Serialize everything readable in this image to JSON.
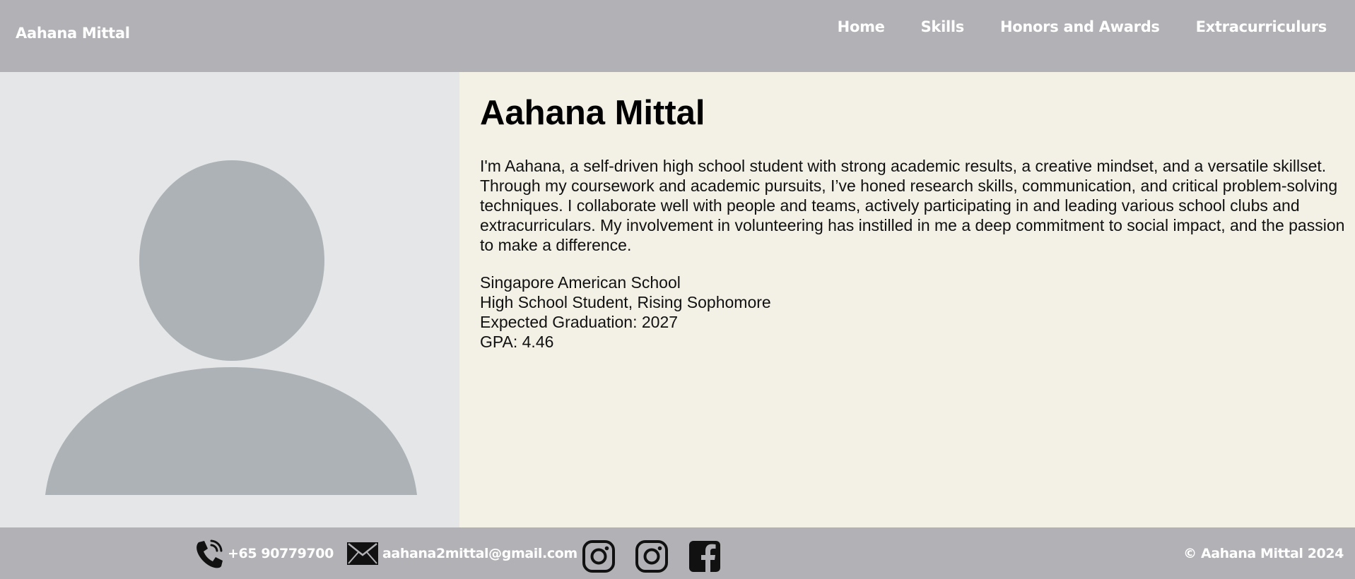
{
  "header": {
    "brand": "Aahana Mittal",
    "nav": [
      {
        "label": "Home"
      },
      {
        "label": "Skills"
      },
      {
        "label": "Honors and Awards"
      },
      {
        "label": "Extracurriculurs"
      }
    ]
  },
  "profile": {
    "avatar_icon": "user-silhouette-icon",
    "name": "Aahana Mittal",
    "bio": "I'm Aahana, a self-driven high school student with strong academic results, a creative mindset, and a versatile skillset. Through my coursework and academic pursuits, I’ve honed research skills, communication, and critical problem-solving techniques. I collaborate well with people and teams, actively participating in and leading various school clubs and extracurriculars. My involvement in volunteering has instilled in me a deep commitment to social impact, and the passion to make a difference.",
    "details": [
      "Singapore American School",
      "High School Student, Rising Sophomore",
      "Expected Graduation: 2027",
      "GPA: 4.46"
    ]
  },
  "footer": {
    "phone_icon": "phone-icon",
    "phone": "+65 90779700",
    "email_icon": "envelope-icon",
    "email": "aahana2mittal@gmail.com",
    "social_icons": [
      "instagram-icon",
      "instagram-icon",
      "facebook-icon"
    ],
    "copyright": "© Aahana Mittal 2024"
  },
  "colors": {
    "header_bg": "#b2b1b6",
    "left_panel_bg": "#e5e6e8",
    "content_bg": "#f3f1e6",
    "avatar_fill": "#adb2b6"
  }
}
